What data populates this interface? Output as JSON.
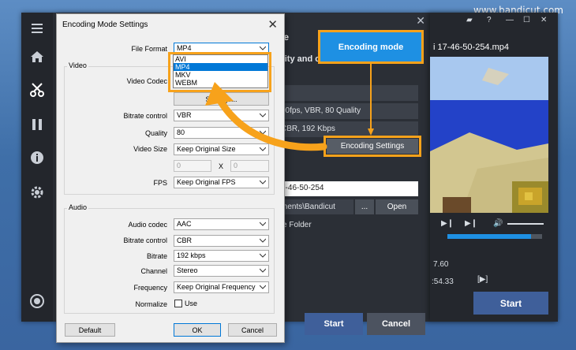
{
  "site_url": "www.bandicut.com",
  "colors": {
    "accent_orange": "#f7a21b",
    "accent_blue": "#1e90e3",
    "app_bg": "#2b2f36"
  },
  "nav_icons": [
    "menu-icon",
    "home-icon",
    "cut-icon",
    "film-icon",
    "info-icon",
    "gear-icon",
    "record-icon"
  ],
  "app": {
    "mode_heading": "mode",
    "encoding_mode_button": "Encoding mode",
    "mode_description": ", quality and codec (Slow)",
    "info_row_1": "",
    "info_row_2": "00fps, VBR, 80 Quality",
    "info_row_3": "CBR, 192 Kbps",
    "encoding_settings_button": "Encoding Settings",
    "filename": "7-46-50-254",
    "folder_path": "ments\\Bandicut",
    "dots_button": "...",
    "open_button": "Open",
    "open_folder_label": "e Folder",
    "start_button": "Start",
    "cancel_button": "Cancel"
  },
  "preview_panel": {
    "file_title": "i 17-46-50-254.mp4",
    "time_a": "7.60",
    "time_b": ":54.33",
    "bracket_buttons": "[▶]",
    "start_button": "Start",
    "timeline_progress": 0.88
  },
  "dialog": {
    "title": "Encoding Mode Settings",
    "file_format_label": "File Format",
    "file_format_value": "MP4",
    "format_options": [
      "AVI",
      "MP4",
      "MKV",
      "WEBM"
    ],
    "format_selected": "MP4",
    "video_group": "Video",
    "video_codec_label": "Video Codec",
    "settings_button": "Settings...",
    "video_bitrate_label": "Bitrate control",
    "video_bitrate_value": "VBR",
    "quality_label": "Quality",
    "quality_value": "80",
    "video_size_label": "Video Size",
    "video_size_value": "Keep Original Size",
    "width_value": "0",
    "x_sep": "X",
    "height_value": "0",
    "fps_label": "FPS",
    "fps_value": "Keep Original FPS",
    "audio_group": "Audio",
    "audio_codec_label": "Audio codec",
    "audio_codec_value": "AAC",
    "audio_bitrate_label": "Bitrate control",
    "audio_bitrate_value": "CBR",
    "bitrate_label": "Bitrate",
    "bitrate_value": "192 kbps",
    "channel_label": "Channel",
    "channel_value": "Stereo",
    "frequency_label": "Frequency",
    "frequency_value": "Keep Original Frequency",
    "normalize_label": "Normalize",
    "use_label": "Use",
    "default_button": "Default",
    "ok_button": "OK",
    "cancel_button": "Cancel"
  }
}
